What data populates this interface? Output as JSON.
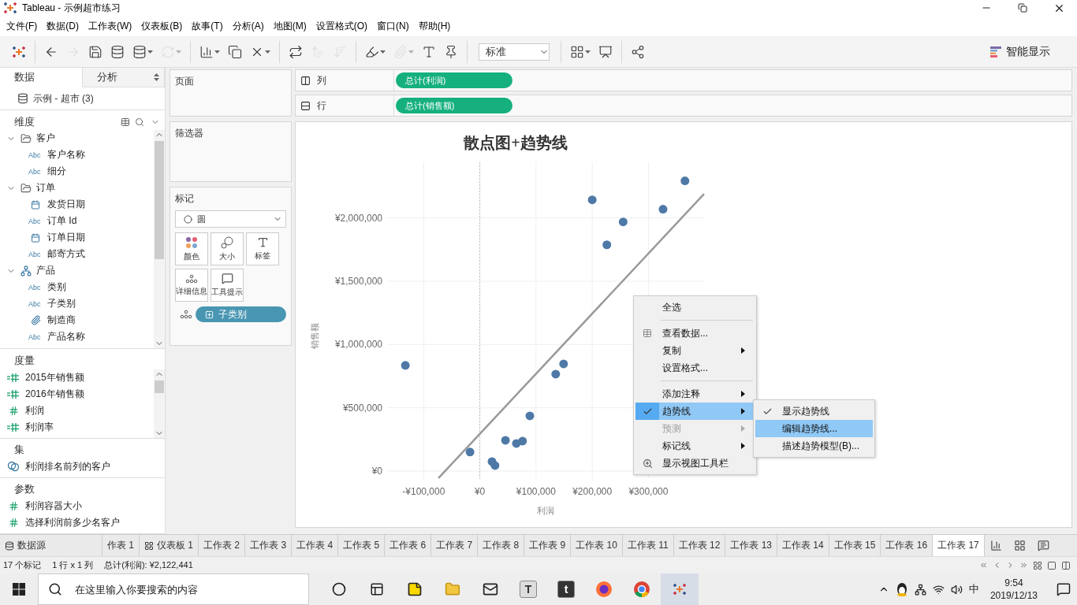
{
  "window": {
    "title": "Tableau - 示例超市练习"
  },
  "menu": [
    "文件(F)",
    "数据(D)",
    "工作表(W)",
    "仪表板(B)",
    "故事(T)",
    "分析(A)",
    "地图(M)",
    "设置格式(O)",
    "窗口(N)",
    "帮助(H)"
  ],
  "toolbar": {
    "tools": [
      {
        "disabled": false
      },
      {
        "disabled": false
      },
      {
        "disabled": true
      },
      {
        "disabled": false
      },
      {
        "disabled": false
      },
      {
        "disabled": false
      },
      {
        "disabled": true
      },
      {
        "disabled": false
      },
      {
        "disabled": false
      },
      {
        "disabled": false
      },
      {
        "disabled": false
      },
      {
        "disabled": true
      },
      {
        "disabled": true
      },
      {
        "disabled": false
      },
      {
        "disabled": true
      },
      {
        "disabled": false
      },
      {
        "disabled": false
      },
      {
        "disabled": false
      },
      {
        "disabled": false
      },
      {
        "disabled": false
      }
    ],
    "fit_dropdown": "标准",
    "show_me": "智能显示"
  },
  "data_pane": {
    "tabs": [
      {
        "label": "数据",
        "selected": true
      },
      {
        "label": "分析",
        "selected": false
      }
    ],
    "datasource": "示例 - 超市 (3)",
    "dimensions": {
      "title": "维度",
      "fields": [
        {
          "kind": "folder",
          "name": "客户",
          "expanded": true,
          "children": [
            {
              "kind": "string",
              "type_label": "Abc",
              "name": "客户名称"
            },
            {
              "kind": "string",
              "type_label": "Abc",
              "name": "细分"
            }
          ]
        },
        {
          "kind": "folder",
          "name": "订单",
          "expanded": true,
          "children": [
            {
              "kind": "date",
              "name": "发货日期"
            },
            {
              "kind": "string",
              "type_label": "Abc",
              "name": "订单 Id"
            },
            {
              "kind": "date",
              "name": "订单日期"
            },
            {
              "kind": "string",
              "type_label": "Abc",
              "name": "邮寄方式"
            }
          ]
        },
        {
          "kind": "hierarchy",
          "name": "产品",
          "expanded": true,
          "children": [
            {
              "kind": "string",
              "type_label": "Abc",
              "name": "类别"
            },
            {
              "kind": "string",
              "type_label": "Abc",
              "name": "子类别"
            },
            {
              "kind": "group",
              "name": "制造商"
            },
            {
              "kind": "string",
              "type_label": "Abc",
              "name": "产品名称"
            }
          ]
        }
      ]
    },
    "measures": {
      "title": "度量",
      "fields": [
        {
          "kind": "calc",
          "name": "2015年销售额"
        },
        {
          "kind": "calc",
          "name": "2016年销售额"
        },
        {
          "kind": "number",
          "name": "利润"
        },
        {
          "kind": "calc",
          "name": "利润率"
        }
      ]
    },
    "sets": {
      "title": "集",
      "fields": [
        {
          "kind": "set",
          "name": "利润排名前列的客户"
        }
      ]
    },
    "parameters": {
      "title": "参数",
      "fields": [
        {
          "kind": "number",
          "name": "利润容器大小"
        },
        {
          "kind": "number",
          "name": "选择利润前多少名客户"
        }
      ]
    }
  },
  "cards": {
    "pages": "页面",
    "filters": "筛选器",
    "marks": {
      "title": "标记",
      "mark_type": "圆",
      "buttons": [
        {
          "kind": "color",
          "label": "颜色"
        },
        {
          "kind": "size",
          "label": "大小"
        },
        {
          "kind": "label",
          "label": "标签"
        },
        {
          "kind": "detail",
          "label": "详细信息"
        },
        {
          "kind": "tooltip",
          "label": "工具提示"
        }
      ],
      "pills": [
        {
          "kind": "detail",
          "name": "子类别"
        }
      ]
    }
  },
  "shelves": [
    {
      "kind": "columns",
      "label": "列",
      "pill": "总计(利润)"
    },
    {
      "kind": "rows",
      "label": "行",
      "pill": "总计(销售额)"
    }
  ],
  "view": {
    "chart_data": {
      "type": "scatter",
      "title": "散点图+趋势线",
      "xlabel": "利润",
      "ylabel": "销售额",
      "xlim": [
        -165000,
        399000
      ],
      "ylim": [
        -60000,
        2440000
      ],
      "xticks": [
        {
          "value": -100000,
          "label": "-¥100,000"
        },
        {
          "value": 0,
          "label": "¥0"
        },
        {
          "value": 100000,
          "label": "¥100,000"
        },
        {
          "value": 200000,
          "label": "¥200,000"
        },
        {
          "value": 300000,
          "label": "¥300,000"
        }
      ],
      "yticks": [
        {
          "value": 0,
          "label": "¥0"
        },
        {
          "value": 500000,
          "label": "¥500,000"
        },
        {
          "value": 1000000,
          "label": "¥1,000,000"
        },
        {
          "value": 1500000,
          "label": "¥1,500,000"
        },
        {
          "value": 2000000,
          "label": "¥2,000,000"
        }
      ],
      "x": [
        -132500,
        -17500,
        21600,
        27000,
        45600,
        65000,
        76000,
        89000,
        135000,
        149000,
        200000,
        226000,
        255000,
        326000,
        365000,
        -73600,
        399000
      ],
      "series": [
        {
          "type": "scatter",
          "color": "#4e79a7",
          "values": [
            835000,
            150000,
            75000,
            44000,
            243000,
            218000,
            237000,
            436000,
            766000,
            847000,
            2143000,
            1788000,
            1969000,
            2069000,
            2293000,
            null,
            null
          ]
        },
        {
          "type": "line",
          "color": "#999999",
          "values": [
            null,
            null,
            null,
            null,
            null,
            null,
            null,
            null,
            null,
            null,
            null,
            null,
            null,
            null,
            null,
            -56000,
            2190000
          ]
        }
      ],
      "grid": true,
      "ref_lines": [
        {
          "axis": "x",
          "value": 0
        }
      ]
    },
    "context_menu": {
      "items": [
        {
          "kind": "plain",
          "label": "全选",
          "checked": false,
          "disabled": false,
          "selected": false,
          "submenu": false
        },
        {
          "kind": "separator"
        },
        {
          "kind": "grid",
          "label": "查看数据...",
          "checked": false,
          "disabled": false,
          "selected": false,
          "submenu": false
        },
        {
          "kind": "plain",
          "label": "复制",
          "checked": false,
          "disabled": false,
          "selected": false,
          "submenu": true
        },
        {
          "kind": "plain",
          "label": "设置格式...",
          "checked": false,
          "disabled": false,
          "selected": false,
          "submenu": false
        },
        {
          "kind": "separator"
        },
        {
          "kind": "plain",
          "label": "添加注释",
          "checked": false,
          "disabled": false,
          "selected": false,
          "submenu": true
        },
        {
          "kind": "plain",
          "label": "趋势线",
          "checked": true,
          "disabled": false,
          "selected": true,
          "submenu": true
        },
        {
          "kind": "plain",
          "label": "预测",
          "checked": false,
          "disabled": true,
          "selected": false,
          "submenu": true
        },
        {
          "kind": "plain",
          "label": "标记线",
          "checked": false,
          "disabled": false,
          "selected": false,
          "submenu": true
        },
        {
          "kind": "zoom",
          "label": "显示视图工具栏",
          "checked": false,
          "disabled": false,
          "selected": false,
          "submenu": false
        }
      ]
    },
    "submenu": {
      "items": [
        {
          "label": "显示趋势线",
          "checked": true,
          "selected": false
        },
        {
          "label": "编辑趋势线...",
          "checked": false,
          "selected": true
        },
        {
          "label": "描述趋势模型(B)...",
          "checked": false,
          "selected": false
        }
      ]
    }
  },
  "sheet_tabs": [
    {
      "kind": "datasource",
      "label": "数据源",
      "selected": false
    },
    {
      "kind": "sheet",
      "label": "作表 1",
      "selected": false
    },
    {
      "kind": "dashboard",
      "label": "仪表板 1",
      "selected": false
    },
    {
      "kind": "sheet",
      "label": "工作表 2",
      "selected": false
    },
    {
      "kind": "sheet",
      "label": "工作表 3",
      "selected": false
    },
    {
      "kind": "sheet",
      "label": "工作表 4",
      "selected": false
    },
    {
      "kind": "sheet",
      "label": "工作表 5",
      "selected": false
    },
    {
      "kind": "sheet",
      "label": "工作表 6",
      "selected": false
    },
    {
      "kind": "sheet",
      "label": "工作表 7",
      "selected": false
    },
    {
      "kind": "sheet",
      "label": "工作表 8",
      "selected": false
    },
    {
      "kind": "sheet",
      "label": "工作表 9",
      "selected": false
    },
    {
      "kind": "sheet",
      "label": "工作表 10",
      "selected": false
    },
    {
      "kind": "sheet",
      "label": "工作表 11",
      "selected": false
    },
    {
      "kind": "sheet",
      "label": "工作表 12",
      "selected": false
    },
    {
      "kind": "sheet",
      "label": "工作表 13",
      "selected": false
    },
    {
      "kind": "sheet",
      "label": "工作表 14",
      "selected": false
    },
    {
      "kind": "sheet",
      "label": "工作表 15",
      "selected": false
    },
    {
      "kind": "sheet",
      "label": "工作表 16",
      "selected": false
    },
    {
      "kind": "sheet",
      "label": "工作表 17",
      "selected": true
    }
  ],
  "status_bar": {
    "marks": "17 个标记",
    "grid": "1 行 x 1 列",
    "sum": "总计(利润): ¥2,122,441"
  },
  "taskbar": {
    "search_placeholder": "在这里输入你要搜索的内容",
    "apps": [
      {
        "kind": "cortana",
        "selected": false
      },
      {
        "kind": "task-view",
        "selected": false
      },
      {
        "kind": "notes",
        "selected": false
      },
      {
        "kind": "explorer",
        "selected": false
      },
      {
        "kind": "mail",
        "selected": false
      },
      {
        "kind": "letter",
        "text": "T",
        "selected": false
      },
      {
        "kind": "letter",
        "text": "t",
        "selected": false
      },
      {
        "kind": "firefox",
        "selected": false
      },
      {
        "kind": "chrome",
        "selected": false
      },
      {
        "kind": "tableau",
        "selected": true
      }
    ],
    "ime": "中",
    "time": "9:54",
    "date": "2019/12/13"
  }
}
